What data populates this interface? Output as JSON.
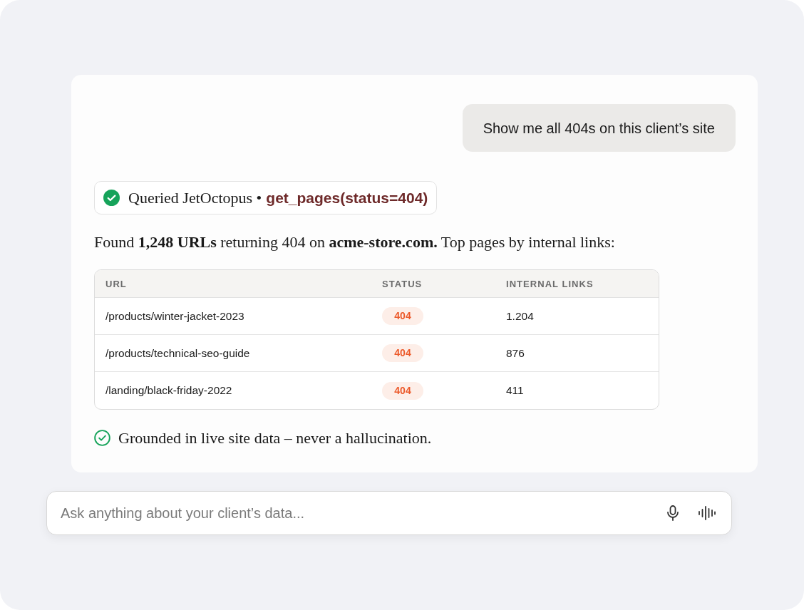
{
  "user_message": {
    "text": "Show me all 404s on this client’s site"
  },
  "tool_call": {
    "label": "Queried JetOctopus •",
    "call": "get_pages(status=404)"
  },
  "answer": {
    "text": "Found **1,248 URLs** returning 404 on **acme-store.com.** Top pages by internal links:"
  },
  "table": {
    "columns": [
      "URL",
      "STATUS",
      "INTERNAL LINKS"
    ],
    "rows": [
      {
        "url": "/products/winter-jacket-2023",
        "status": "404",
        "internal_links": "1.204"
      },
      {
        "url": "/products/technical-seo-guide",
        "status": "404",
        "internal_links": "876"
      },
      {
        "url": "/landing/black-friday-2022",
        "status": "404",
        "internal_links": "411"
      }
    ]
  },
  "footnote": {
    "text": "Grounded in live site data – never a hallucination."
  },
  "composer": {
    "placeholder": "Ask anything about your client’s data..."
  }
}
